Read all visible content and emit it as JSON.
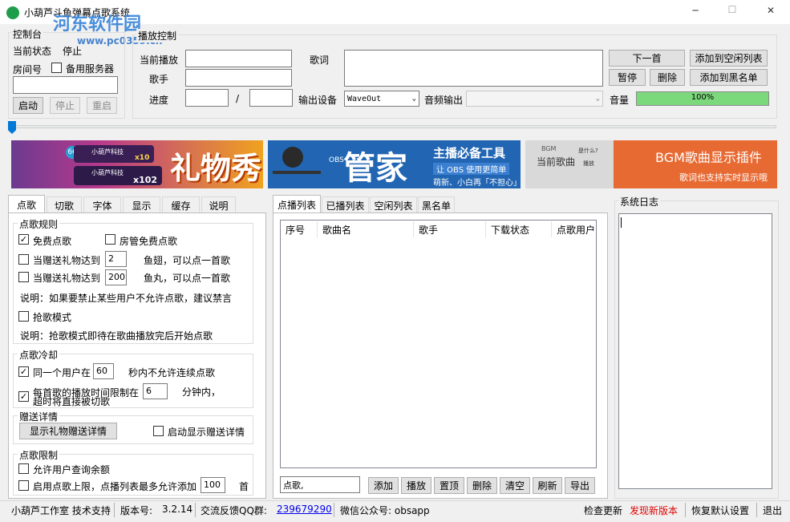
{
  "window": {
    "title": "小葫芦斗鱼弹幕点歌系统",
    "min": "─",
    "max": "☐",
    "close": "✕"
  },
  "watermark": {
    "site": "河东软件园",
    "url": "www.pc0359.cn"
  },
  "console": {
    "group": "控制台",
    "status_label": "当前状态",
    "status_value": "停止",
    "room_label": "房间号",
    "backup_label": "备用服务器",
    "room_value": "",
    "start": "启动",
    "stop": "停止",
    "restart": "重启"
  },
  "playback": {
    "group": "播放控制",
    "current_label": "当前播放",
    "singer_label": "歌手",
    "progress_label": "进度",
    "slash": "/",
    "lyrics_label": "歌词",
    "output_device_label": "输出设备",
    "output_device_value": "WaveOut",
    "audio_output_label": "音频输出",
    "volume_label": "音量",
    "volume_text": "100%",
    "volume": 1.0,
    "next": "下一首",
    "add_idle": "添加到空闲列表",
    "pause": "暂停",
    "delete": "删除",
    "add_blacklist": "添加到黑名单"
  },
  "seek": {
    "position": 0
  },
  "banners": {
    "gift": {
      "badge": "666",
      "user1": "小葫芦科技",
      "x10": "x10",
      "user2": "小葫芦科技",
      "x102": "x102",
      "title": "礼物秀"
    },
    "tool": {
      "title": "主播必备工具",
      "sub1": "让 OBS 使用更简单",
      "sub2": "萌新、小白再「不担心」",
      "big": "管家",
      "obs": "OBS"
    },
    "bgm": {
      "small": "BGM",
      "music": "当前歌曲",
      "what": "是什么?",
      "play": "播放",
      "title": "BGM歌曲显示插件",
      "sub": "歌词也支持实时显示哦"
    }
  },
  "left_tabs": [
    "点歌",
    "切歌",
    "字体",
    "显示",
    "缓存",
    "说明"
  ],
  "rules": {
    "group": "点歌规则",
    "free": "免费点歌",
    "free_checked": true,
    "admin_free": "房管免费点歌",
    "admin_checked": false,
    "wing_pre": "当赠送礼物达到",
    "wing_val": "2",
    "wing_post": "鱼翅，可以点一首歌",
    "wing_checked": false,
    "ball_pre": "当赠送礼物达到",
    "ball_val": "200",
    "ball_post": "鱼丸，可以点一首歌",
    "ball_checked": false,
    "note1": "说明：如果要禁止某些用户不允许点歌，建议禁言",
    "grab": "抢歌模式",
    "grab_checked": false,
    "note2": "说明：抢歌模式即待在歌曲播放完后开始点歌"
  },
  "cooldown": {
    "group": "点歌冷却",
    "same_pre": "同一个用户在",
    "same_val": "60",
    "same_post": "秒内不允许连续点歌",
    "same_checked": true,
    "limit_l1": "每首歌的播放时间限制在",
    "limit_l2": "超时将直接被切歌",
    "limit_val": "6",
    "limit_post": "分钟内，",
    "limit_checked": true
  },
  "gift_detail": {
    "group": "赠送详情",
    "show_btn": "显示礼物赠送详情",
    "auto": "启动显示赠送详情",
    "auto_checked": false
  },
  "limits": {
    "group": "点歌限制",
    "query": "允许用户查询余额",
    "query_checked": false,
    "cap_pre": "启用点歌上限，点播列表最多允许添加",
    "cap_val": "100",
    "cap_post": "首",
    "cap_checked": false
  },
  "mid_tabs": [
    "点播列表",
    "已播列表",
    "空闲列表",
    "黑名单"
  ],
  "list": {
    "cols": [
      "序号",
      "歌曲名",
      "歌手",
      "下载状态",
      "点歌用户"
    ],
    "input": "点歌,",
    "buttons": [
      "添加",
      "播放",
      "置顶",
      "删除",
      "清空",
      "刷新",
      "导出"
    ]
  },
  "log": {
    "group": "系统日志"
  },
  "status": {
    "studio": "小葫芦工作室 技术支持",
    "ver_label": "版本号:",
    "ver": "3.2.14",
    "qq_label": "交流反馈QQ群:",
    "qq": "239679290",
    "wx": "微信公众号: obsapp",
    "check": "检查更新",
    "newver": "发现新版本",
    "restore": "恢复默认设置",
    "exit": "退出"
  },
  "colors": {
    "accent": "#0078d7",
    "volume": "#7bd87b",
    "banner_orange": "#e86a33",
    "banner_blue": "#1f5fa8",
    "link": "#0000ee",
    "red": "#e00000"
  }
}
